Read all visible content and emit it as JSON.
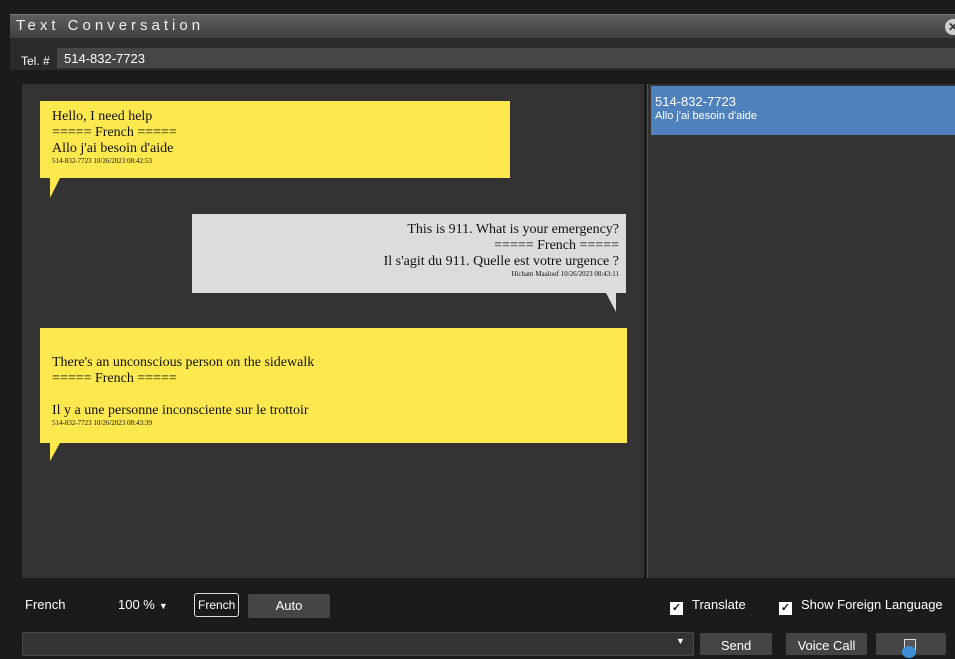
{
  "window": {
    "title": "Text Conversation"
  },
  "tel": {
    "label": "Tel. #",
    "value": "514-832-7723"
  },
  "messages": [
    {
      "lines": [
        "Hello, I need help",
        "===== French =====",
        "Allo j'ai besoin d'aide"
      ],
      "meta": "514-832-7723 10/26/2023 08:42:53"
    },
    {
      "lines": [
        "This is 911. What is your emergency?",
        "===== French =====",
        "Il s'agit du 911. Quelle est votre urgence ?"
      ],
      "meta": "Hicham Maalouf 10/26/2023 08:43:11"
    },
    {
      "lines": [
        "There's an unconscious person on the sidewalk",
        "===== French =====",
        "Il y a une personne inconsciente sur le trottoir"
      ],
      "meta": "514-832-7723 10/26/2023 08:43:39"
    }
  ],
  "conversations": [
    {
      "phone": "514-832-7723",
      "preview": "Allo j'ai besoin d'aide"
    }
  ],
  "controls": {
    "language": "French",
    "zoom": "100 %",
    "french_button": "French",
    "auto_button": "Auto",
    "translate_label": "Translate",
    "show_foreign_label": "Show Foreign Language",
    "send_button": "Send",
    "voice_call_button": "Voice Call"
  },
  "colors": {
    "incoming_bubble": "#fde94d",
    "outgoing_bubble": "#dcdcdc",
    "selected_conversation": "#4f81bd"
  }
}
